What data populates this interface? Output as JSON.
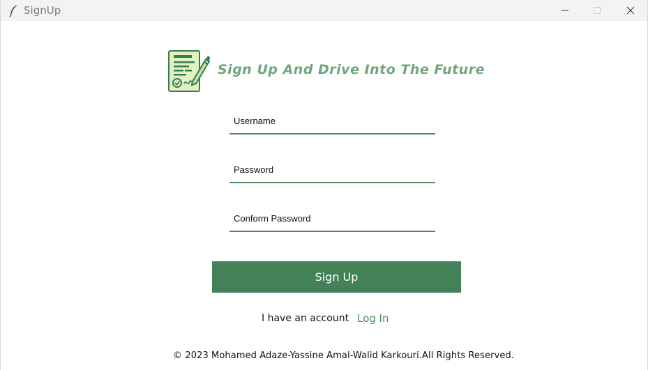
{
  "window": {
    "title": "SignUp",
    "app_icon": "feather-icon"
  },
  "header": {
    "heading": "Sign Up And Drive Into The Future",
    "logo_icon": "signed-document-pen-icon"
  },
  "form": {
    "username_label": "Username",
    "password_label": "Password",
    "confirm_password_label": "Conform Password",
    "submit_label": "Sign Up"
  },
  "account": {
    "prompt": "I have an account",
    "login_label": "Log In"
  },
  "footer": {
    "text": "© 2023  Mohamed Adaze-Yassine Amal-Walid Karkouri.All Rights Reserved."
  },
  "colors": {
    "accent": "#438158",
    "heading": "#6fa77c",
    "underline": "#4a8a5f"
  }
}
